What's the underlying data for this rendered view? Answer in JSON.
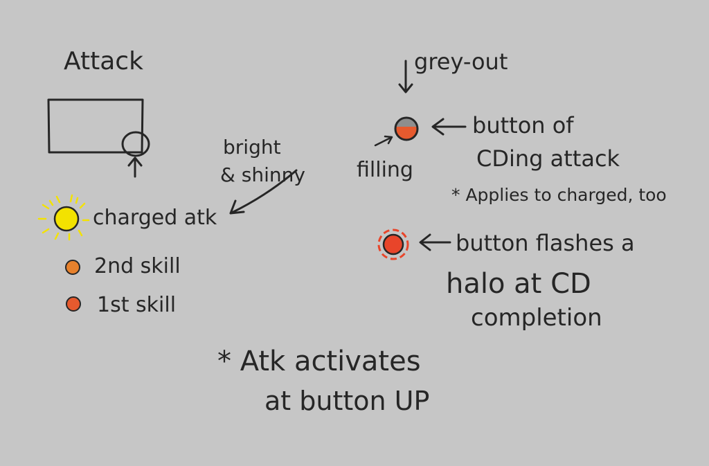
{
  "colors": {
    "background": "#c6c6c6",
    "ink": "#262626",
    "charged_yellow": "#f3e200",
    "skill2_orange": "#e7812c",
    "skill1_red": "#e65a2e",
    "halo_red": "#e8452a",
    "grey_button": "#8e8e8e"
  },
  "left": {
    "title": "Attack",
    "annotation_line1": "bright",
    "annotation_line2": "& shinny",
    "legend": [
      {
        "label": "charged atk",
        "color": "#f3e200",
        "icon": "glowing-yellow-dot"
      },
      {
        "label": "2nd skill",
        "color": "#e7812c",
        "icon": "orange-dot"
      },
      {
        "label": "1st skill",
        "color": "#e65a2e",
        "icon": "red-dot"
      }
    ]
  },
  "right": {
    "grey_out_label": "grey-out",
    "filling_label": "filling",
    "cd_button_label_line1": "button of",
    "cd_button_label_line2": "CDing attack",
    "cd_note": "* Applies to charged, too",
    "halo_label_line1": "button flashes a",
    "halo_label_line2": "halo at CD",
    "halo_label_line3": "completion"
  },
  "footer": {
    "note_line1": "* Atk activates",
    "note_line2": "at button UP"
  }
}
